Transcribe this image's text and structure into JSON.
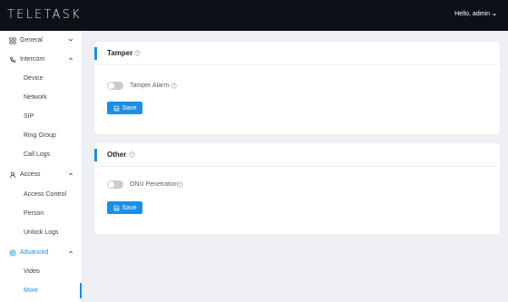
{
  "header": {
    "brand": "TELETASK",
    "greeting": "Hello, admin"
  },
  "sidebar": {
    "groups": [
      {
        "label": "General",
        "icon": "grid-icon",
        "expanded": false
      },
      {
        "label": "Intercom",
        "icon": "phone-icon",
        "expanded": true,
        "items": [
          "Device",
          "Network",
          "SIP",
          "Ring Group",
          "Call Logs"
        ]
      },
      {
        "label": "Access",
        "icon": "person-icon",
        "expanded": true,
        "items": [
          "Access Control",
          "Person",
          "Unlock Logs"
        ]
      },
      {
        "label": "Advanced",
        "icon": "gear-icon",
        "expanded": true,
        "active": true,
        "items": [
          "Video",
          "More"
        ]
      }
    ],
    "active_item": "More"
  },
  "sections": {
    "tamper": {
      "title": "Tamper",
      "toggle_label": "Tamper Alarm",
      "toggle_on": false,
      "save_label": "Save"
    },
    "other": {
      "title": "Other",
      "toggle_label": "ONU Penetration",
      "toggle_on": false,
      "save_label": "Save"
    }
  },
  "colors": {
    "accent": "#1b8fe6",
    "topbar": "#0d1117",
    "background": "#eef0f4"
  }
}
